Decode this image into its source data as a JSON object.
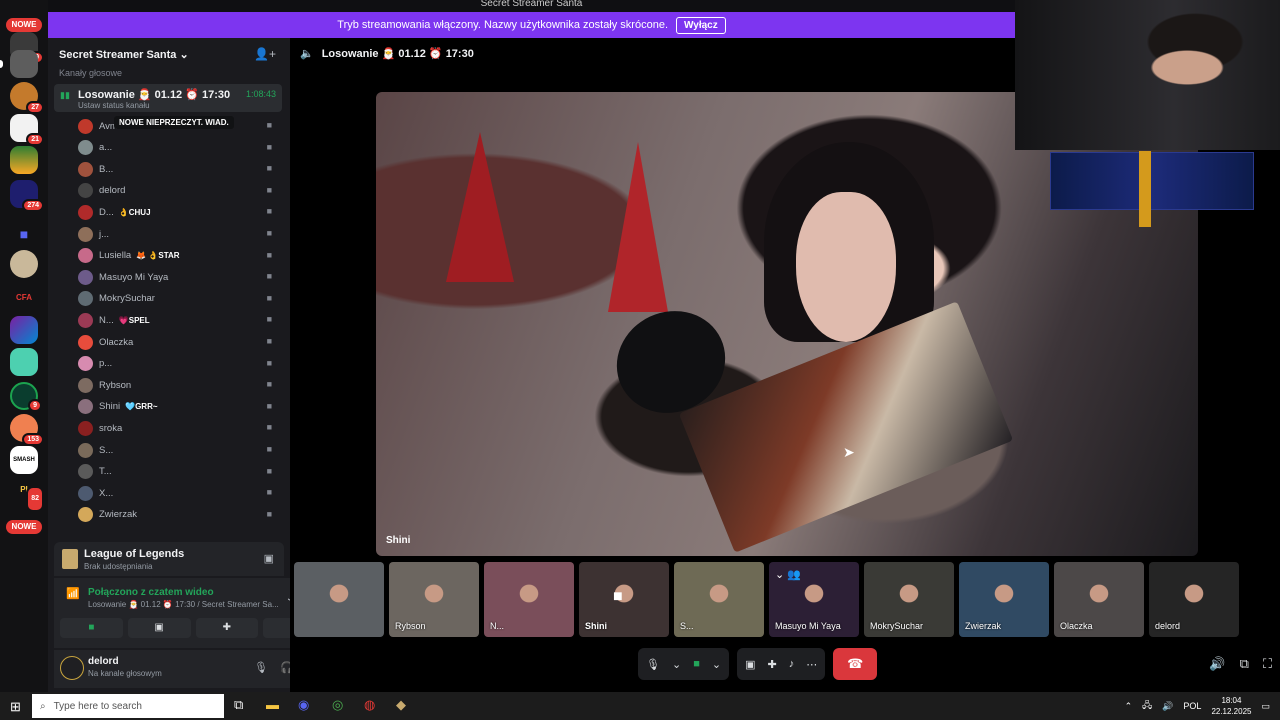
{
  "window": {
    "title": "Secret Streamer Santa"
  },
  "banner": {
    "text": "Tryb streamowania włączony. Nazwy użytkownika zostały skrócone.",
    "button": "Wyłącz"
  },
  "rail": {
    "badges": [
      {
        "label": "NOWE"
      },
      {
        "label": "NOWE"
      }
    ],
    "counts": [
      "19",
      "27",
      "21",
      "274",
      "9",
      "153",
      "82"
    ],
    "cfa_label": "CFA",
    "smash_label": "SMASH",
    "pi_label": "PI"
  },
  "server": {
    "name": "Secret Streamer Santa",
    "category": "Kanały głosowe"
  },
  "tooltip": "NOWE NIEPRZECZYT. WIAD.",
  "voice_channel": {
    "name": "Losowanie 🎅 01.12 ⏰ 17:30",
    "status": "Ustaw status kanału",
    "timer": "1:08:43"
  },
  "members": [
    {
      "name": "Avmusia",
      "tag": "",
      "color": "#c0392b"
    },
    {
      "name": "a...",
      "tag": "",
      "color": "#7f8c8d"
    },
    {
      "name": "B...",
      "tag": "",
      "color": "#a0523d"
    },
    {
      "name": "delord",
      "tag": "",
      "color": "#444"
    },
    {
      "name": "D...",
      "tag": "👌CHUJ",
      "color": "#b02a2a"
    },
    {
      "name": "j...",
      "tag": "",
      "color": "#8e6f5a"
    },
    {
      "name": "Lusiella",
      "tag": "🦊 👌STAR",
      "color": "#c76a8a"
    },
    {
      "name": "Masuyo Mi Yaya",
      "tag": "",
      "color": "#6d5b8a"
    },
    {
      "name": "MokrySuchar",
      "tag": "",
      "color": "#5f6b73"
    },
    {
      "name": "N...",
      "tag": "💗SPEL",
      "color": "#9b3a55"
    },
    {
      "name": "Olaczka",
      "tag": "",
      "color": "#e74c3c"
    },
    {
      "name": "p...",
      "tag": "",
      "color": "#d78bb0"
    },
    {
      "name": "Rybson",
      "tag": "",
      "color": "#7d6b61"
    },
    {
      "name": "Shini",
      "tag": "🩵GRR~",
      "color": "#8a6f7d"
    },
    {
      "name": "sroka",
      "tag": "",
      "color": "#8a2020"
    },
    {
      "name": "S...",
      "tag": "",
      "color": "#7a6a5a"
    },
    {
      "name": "T...",
      "tag": "",
      "color": "#5a5a5a"
    },
    {
      "name": "X...",
      "tag": "",
      "color": "#4d5a70"
    },
    {
      "name": "Zwierzak",
      "tag": "",
      "color": "#d4a85a"
    }
  ],
  "activity": {
    "title": "League of Legends",
    "subtitle": "Brak udostępniania"
  },
  "connection": {
    "title": "Połączono z czatem wideo",
    "subtitle": "Losowanie 🎅 01.12 ⏰ 17:30 / Secret Streamer Sa..."
  },
  "user": {
    "name": "delord",
    "status": "Na kanale głosowym"
  },
  "main": {
    "header": "Losowanie 🎅 01.12 ⏰ 17:30",
    "stage_label": "Shini",
    "thumbnails": [
      {
        "label": "",
        "bg": "#5b5f63"
      },
      {
        "label": "Rybson",
        "bg": "#6c6660"
      },
      {
        "label": "N...",
        "bg": "#7a4e5a"
      },
      {
        "label": "Shini",
        "bg": "#3d3232"
      },
      {
        "label": "S...",
        "bg": "#6e6a55"
      },
      {
        "label": "Masuyo Mi Yaya",
        "bg": "#2c1f35"
      },
      {
        "label": "MokrySuchar",
        "bg": "#3a3a36"
      },
      {
        "label": "Zwierzak",
        "bg": "#304a63"
      },
      {
        "label": "Olaczka",
        "bg": "#4c4848"
      },
      {
        "label": "delord",
        "bg": "#252525"
      }
    ]
  },
  "taskbar": {
    "search_placeholder": "Type here to search",
    "lang": "POL",
    "time": "18:04",
    "date": "22.12.2025"
  }
}
